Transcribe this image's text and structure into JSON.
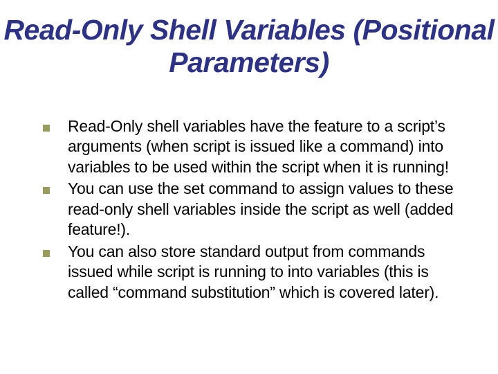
{
  "slide": {
    "title": "Read-Only Shell Variables (Positional Parameters)",
    "bullets": [
      "Read-Only shell variables have the feature to a script’s arguments (when script is issued like a command) into variables to be used within the script when it is running!",
      "You can use the set command to assign values to these read-only shell variables inside the script as well (added feature!).",
      "You can also store standard output from commands issued while script is running to into variables (this is called “command substitution” which is covered later)."
    ]
  }
}
